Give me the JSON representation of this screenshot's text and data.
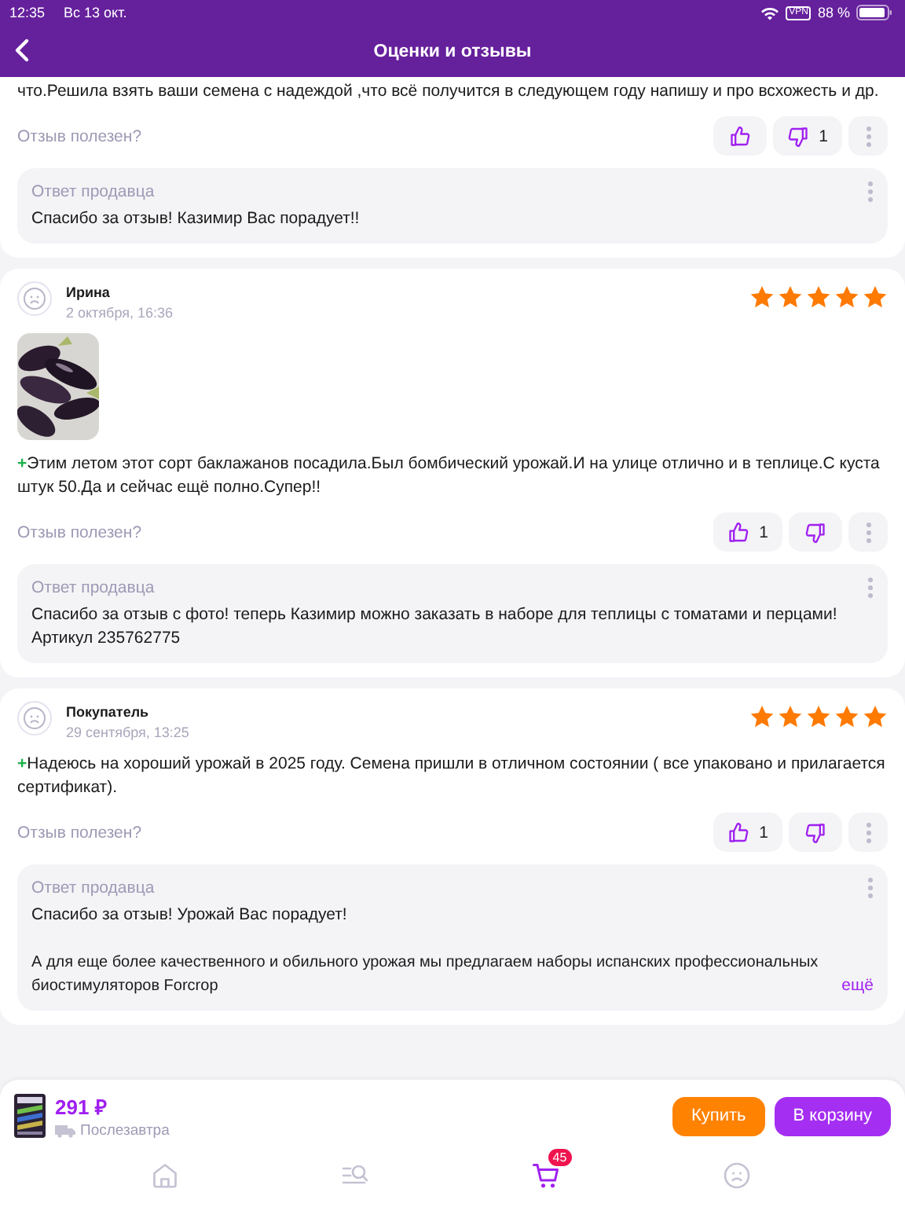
{
  "status_bar": {
    "time": "12:35",
    "date": "Вс 13 окт.",
    "vpn": "VPN",
    "battery": "88 %"
  },
  "header": {
    "title": "Оценки и отзывы"
  },
  "reviews": [
    {
      "text": "что.Решила взять ваши семена с надеждой ,что всё получится в следующем году напишу  и про всхожесть и др.",
      "helpful_label": "Отзыв полезен?",
      "dislikes": "1",
      "reply": {
        "title": "Ответ продавца",
        "paragraphs": [
          "Спасибо за отзыв! Казимир Вас порадует!!"
        ]
      }
    },
    {
      "author": "Ирина",
      "date": "2 октября, 16:36",
      "stars": 5,
      "marker": "+",
      "text": "Этим летом этот сорт баклажанов посадила.Был бомбический урожай.И на улице отлично и в теплице.С куста штук 50.Да и сейчас ещё полно.Супер!!",
      "helpful_label": "Отзыв полезен?",
      "likes": "1",
      "reply": {
        "title": "Ответ продавца",
        "paragraphs": [
          "Спасибо за отзыв с фото! теперь Казимир можно заказать в наборе для теплицы с томатами и перцами! Артикул 235762775"
        ]
      }
    },
    {
      "author": "Покупатель",
      "date": "29 сентября, 13:25",
      "stars": 5,
      "marker": "+",
      "text": "Надеюсь на хороший урожай в 2025 году. Семена пришли в отличном состоянии ( все упаковано и прилагается сертификат).",
      "helpful_label": "Отзыв полезен?",
      "likes": "1",
      "reply": {
        "title": "Ответ продавца",
        "paragraphs": [
          "Спасибо за отзыв! Урожай Вас порадует!",
          "А для еще более качественного и обильного урожая мы предлагаем наборы испанских профессиональных биостимуляторов Forcrop"
        ],
        "more": "ещё"
      }
    }
  ],
  "product_bar": {
    "price": "291 ₽",
    "delivery": "Послезавтра",
    "buttons": [
      {
        "label": "Купить",
        "kind": "buy"
      },
      {
        "label": "В корзину",
        "kind": "cart"
      }
    ]
  },
  "tab_bar": [
    {
      "kind": "home",
      "selected": false
    },
    {
      "kind": "catalog",
      "selected": false
    },
    {
      "kind": "cart",
      "selected": true,
      "badge": "45"
    },
    {
      "kind": "profile",
      "selected": false
    }
  ]
}
